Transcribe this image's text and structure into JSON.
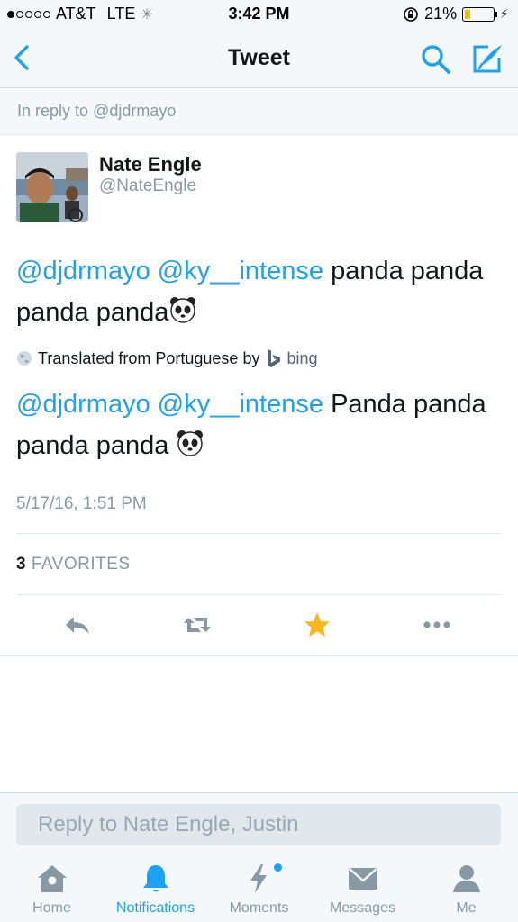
{
  "status_bar": {
    "carrier": "AT&T",
    "network": "LTE",
    "time": "3:42 PM",
    "battery": "21%",
    "battery_level": 0.21
  },
  "nav": {
    "title": "Tweet"
  },
  "in_reply_to": "In reply to @djdrmayo",
  "tweet": {
    "author_name": "Nate Engle",
    "author_handle": "@NateEngle",
    "original": {
      "mention1": "@djdrmayo",
      "mention2": "@ky__intense",
      "text": "panda panda panda panda"
    },
    "translated_label": "Translated from Portuguese by",
    "translator": "bing",
    "translation": {
      "mention1": "@djdrmayo",
      "mention2": "@ky__intense",
      "text": "Panda panda panda panda"
    },
    "timestamp": "5/17/16, 1:51 PM",
    "favorites_count": "3",
    "favorites_label": "FAVORITES"
  },
  "reply": {
    "placeholder": "Reply to Nate Engle, Justin"
  },
  "tabs": [
    {
      "label": "Home"
    },
    {
      "label": "Notifications"
    },
    {
      "label": "Moments"
    },
    {
      "label": "Messages"
    },
    {
      "label": "Me"
    }
  ],
  "colors": {
    "accent": "#1da1f2",
    "favorite": "#fab81e",
    "muted": "#8899a6"
  }
}
